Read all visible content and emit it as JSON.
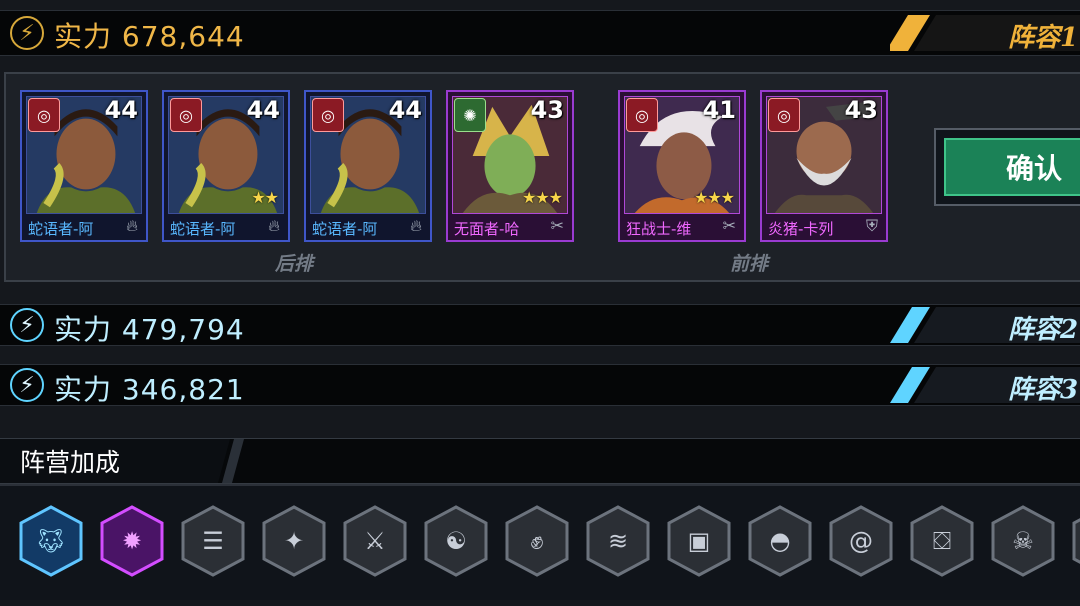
{
  "lineups": [
    {
      "power_label": "实力",
      "power_value": "678,644",
      "tab_label": "阵容1",
      "active": true
    },
    {
      "power_label": "实力",
      "power_value": "479,794",
      "tab_label": "阵容2",
      "active": false
    },
    {
      "power_label": "实力",
      "power_value": "346,821",
      "tab_label": "阵容3",
      "active": false
    }
  ],
  "heroes": [
    {
      "name": "蛇语者-阿",
      "level": "44",
      "stars": "",
      "faction": "red",
      "class_icon": "flame-icon"
    },
    {
      "name": "蛇语者-阿",
      "level": "44",
      "stars": "★★",
      "faction": "red",
      "class_icon": "flame-icon"
    },
    {
      "name": "蛇语者-阿",
      "level": "44",
      "stars": "",
      "faction": "red",
      "class_icon": "flame-icon"
    },
    {
      "name": "无面者-哈",
      "level": "43",
      "stars": "★★★",
      "faction": "green",
      "class_icon": "claw-icon"
    },
    {
      "name": "狂战士-维",
      "level": "41",
      "stars": "★★★",
      "faction": "red",
      "class_icon": "claw-icon"
    },
    {
      "name": "炎猪-卡列",
      "level": "43",
      "stars": "",
      "faction": "red",
      "class_icon": "shield-icon"
    }
  ],
  "row_labels": {
    "back": "后排",
    "front": "前排"
  },
  "confirm_label": "确认",
  "faction_bonus_title": "阵营加成",
  "faction_icons": [
    {
      "name": "wolf-faction-icon",
      "active": true,
      "color": "#39a9ff"
    },
    {
      "name": "beast-faction-icon",
      "active": true,
      "color": "#d34dff"
    },
    {
      "name": "ladder-faction-icon",
      "active": false
    },
    {
      "name": "dragon-faction-icon",
      "active": false
    },
    {
      "name": "blade-faction-icon",
      "active": false
    },
    {
      "name": "cat-faction-icon",
      "active": false
    },
    {
      "name": "fist-faction-icon",
      "active": false
    },
    {
      "name": "water-faction-icon",
      "active": false
    },
    {
      "name": "armor-faction-icon",
      "active": false
    },
    {
      "name": "mask-faction-icon",
      "active": false
    },
    {
      "name": "spiral-faction-icon",
      "active": false
    },
    {
      "name": "chest-faction-icon",
      "active": false
    },
    {
      "name": "skull-faction-icon",
      "active": false
    }
  ],
  "colors": {
    "gold": "#d7a83a",
    "cyan": "#5fd4ff",
    "accent_blue": "#3f56c8",
    "accent_purple": "#9a3bd1",
    "confirm_green": "#1b8257"
  }
}
